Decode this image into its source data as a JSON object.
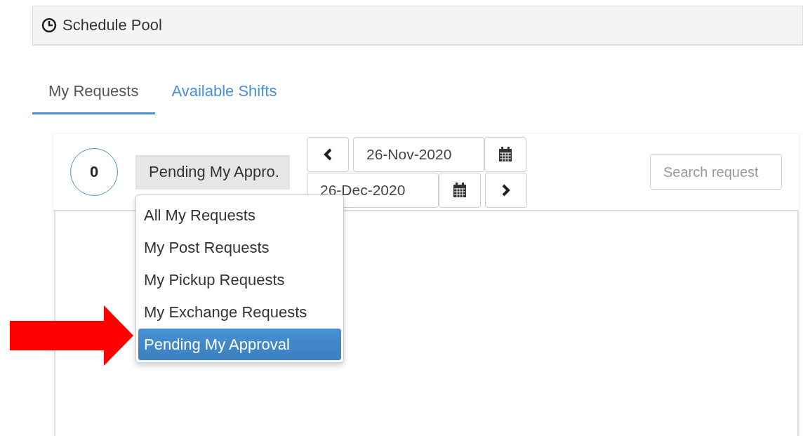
{
  "header": {
    "title": "Schedule Pool"
  },
  "tabs": [
    {
      "label": "My Requests",
      "selected": true
    },
    {
      "label": "Available Shifts",
      "selected": false
    }
  ],
  "toolbar": {
    "count": "0",
    "filter": {
      "value": "Pending My Appro.",
      "expanded": true
    },
    "start_date": "26-Nov-2020",
    "end_date": "26-Dec-2020",
    "search": {
      "placeholder": "Search request"
    }
  },
  "filter_menu": [
    {
      "label": "All My Requests",
      "selected": false
    },
    {
      "label": "My Post Requests",
      "selected": false
    },
    {
      "label": "My Pickup Requests",
      "selected": false
    },
    {
      "label": "My Exchange Requests",
      "selected": false
    },
    {
      "label": "Pending My Approval",
      "selected": true
    }
  ]
}
